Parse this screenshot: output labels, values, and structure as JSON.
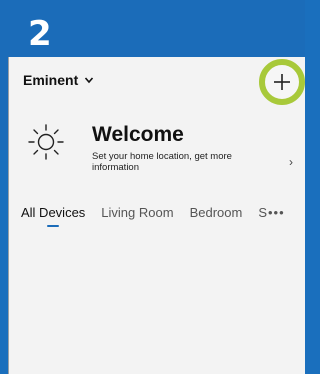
{
  "step": "2",
  "header": {
    "home_name": "Eminent",
    "add_icon": "plus-icon"
  },
  "welcome": {
    "icon": "sun-icon",
    "title": "Welcome",
    "subtitle": "Set your home location, get more information",
    "arrow": "›"
  },
  "tabs": [
    {
      "label": "All Devices",
      "active": true
    },
    {
      "label": "Living Room",
      "active": false
    },
    {
      "label": "Bedroom",
      "active": false
    },
    {
      "label": "S•••",
      "active": false
    }
  ],
  "colors": {
    "banner": "#1b6cb9",
    "highlight_ring": "#a8c93a",
    "screen_bg": "#f3f3f3"
  }
}
